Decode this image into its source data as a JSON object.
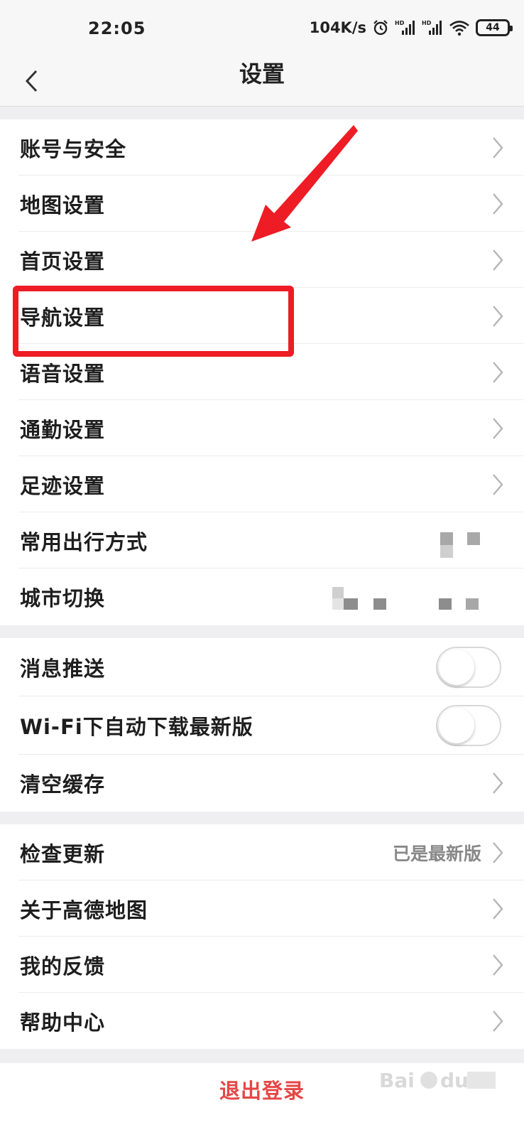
{
  "status_bar": {
    "time": "22:05",
    "speed": "104K/s",
    "battery": "44",
    "icons": [
      "alarm-icon",
      "hd-signal-icon",
      "hd-signal-icon",
      "wifi-icon",
      "battery-icon"
    ]
  },
  "header": {
    "title": "设置",
    "back_icon": "chevron-left-icon"
  },
  "groups": {
    "main": [
      {
        "label": "账号与安全"
      },
      {
        "label": "地图设置"
      },
      {
        "label": "首页设置"
      },
      {
        "label": "导航设置"
      },
      {
        "label": "语音设置"
      },
      {
        "label": "通勤设置"
      },
      {
        "label": "足迹设置"
      },
      {
        "label": "常用出行方式"
      },
      {
        "label": "城市切换"
      }
    ],
    "toggles": [
      {
        "label": "消息推送",
        "on": false
      },
      {
        "label": "Wi-Fi下自动下载最新版",
        "on": false
      },
      {
        "label": "清空缓存"
      }
    ],
    "about": [
      {
        "label": "检查更新",
        "value": "已是最新版"
      },
      {
        "label": "关于高德地图"
      },
      {
        "label": "我的反馈"
      },
      {
        "label": "帮助中心"
      }
    ]
  },
  "logout_label": "退出登录",
  "annotation": {
    "highlight_color": "#ee1c25",
    "highlighted_item": "导航设置"
  },
  "colors": {
    "page_bg": "#efeff1",
    "logout": "#e64646",
    "chevron": "#b5b5b5"
  }
}
